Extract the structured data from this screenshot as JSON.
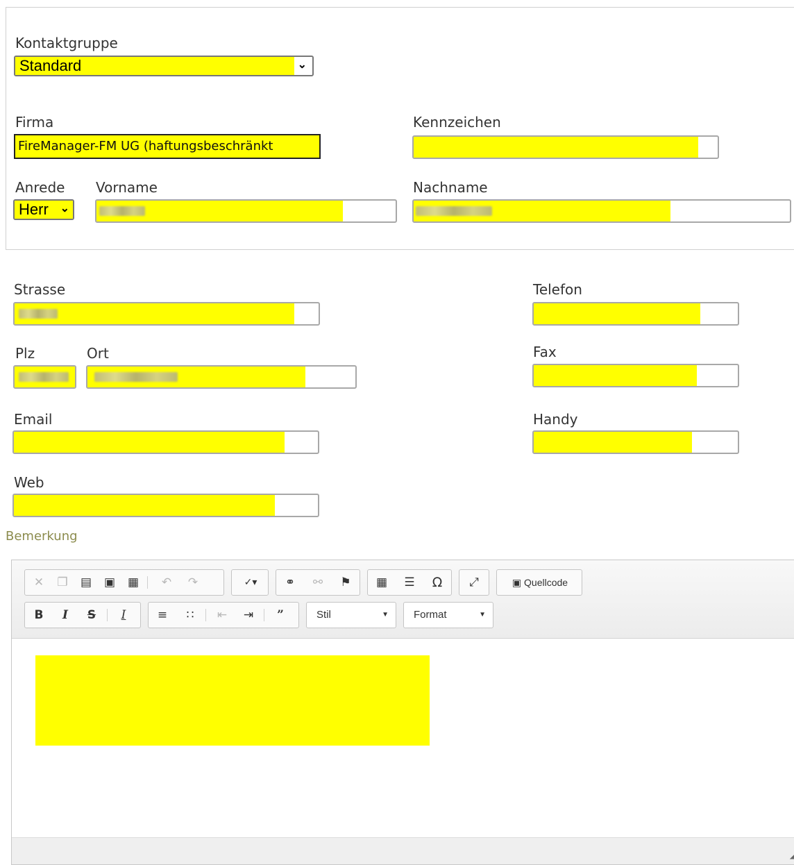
{
  "colors": {
    "highlight": "#ffff00",
    "label": "#333333",
    "bemerkung_label": "#8c8c4e"
  },
  "kontaktgruppe": {
    "label": "Kontaktgruppe",
    "value": "Standard"
  },
  "firma": {
    "label": "Firma",
    "value": "FireManager-FM UG (haftungsbeschränkt"
  },
  "kennzeichen": {
    "label": "Kennzeichen"
  },
  "anrede": {
    "label": "Anrede",
    "value": "Herr"
  },
  "vorname": {
    "label": "Vorname"
  },
  "nachname": {
    "label": "Nachname"
  },
  "strasse": {
    "label": "Strasse"
  },
  "telefon": {
    "label": "Telefon"
  },
  "plz": {
    "label": "Plz"
  },
  "ort": {
    "label": "Ort"
  },
  "fax": {
    "label": "Fax"
  },
  "email": {
    "label": "Email"
  },
  "handy": {
    "label": "Handy"
  },
  "web": {
    "label": "Web"
  },
  "bemerkung": {
    "label": "Bemerkung"
  },
  "editor": {
    "toolbar_row1": {
      "clipboard": [
        "cut-icon",
        "copy-icon",
        "paste-icon",
        "paste-text-icon",
        "paste-word-icon"
      ],
      "history": [
        "undo-icon",
        "redo-icon"
      ],
      "spellcheck": [
        "spellcheck-icon"
      ],
      "links": [
        "link-icon",
        "unlink-icon",
        "anchor-icon"
      ],
      "insert": [
        "table-icon",
        "horizontal-line-icon",
        "special-char-icon"
      ],
      "maximize": [
        "maximize-icon"
      ],
      "source_label": "Quellcode"
    },
    "toolbar_row2": {
      "basic": [
        "bold-icon",
        "italic-icon",
        "strike-icon",
        "remove-format-icon"
      ],
      "lists": [
        "numbered-list-icon",
        "bulleted-list-icon",
        "outdent-icon",
        "indent-icon",
        "blockquote-icon"
      ],
      "style_combo": "Stil",
      "format_combo": "Format"
    }
  }
}
